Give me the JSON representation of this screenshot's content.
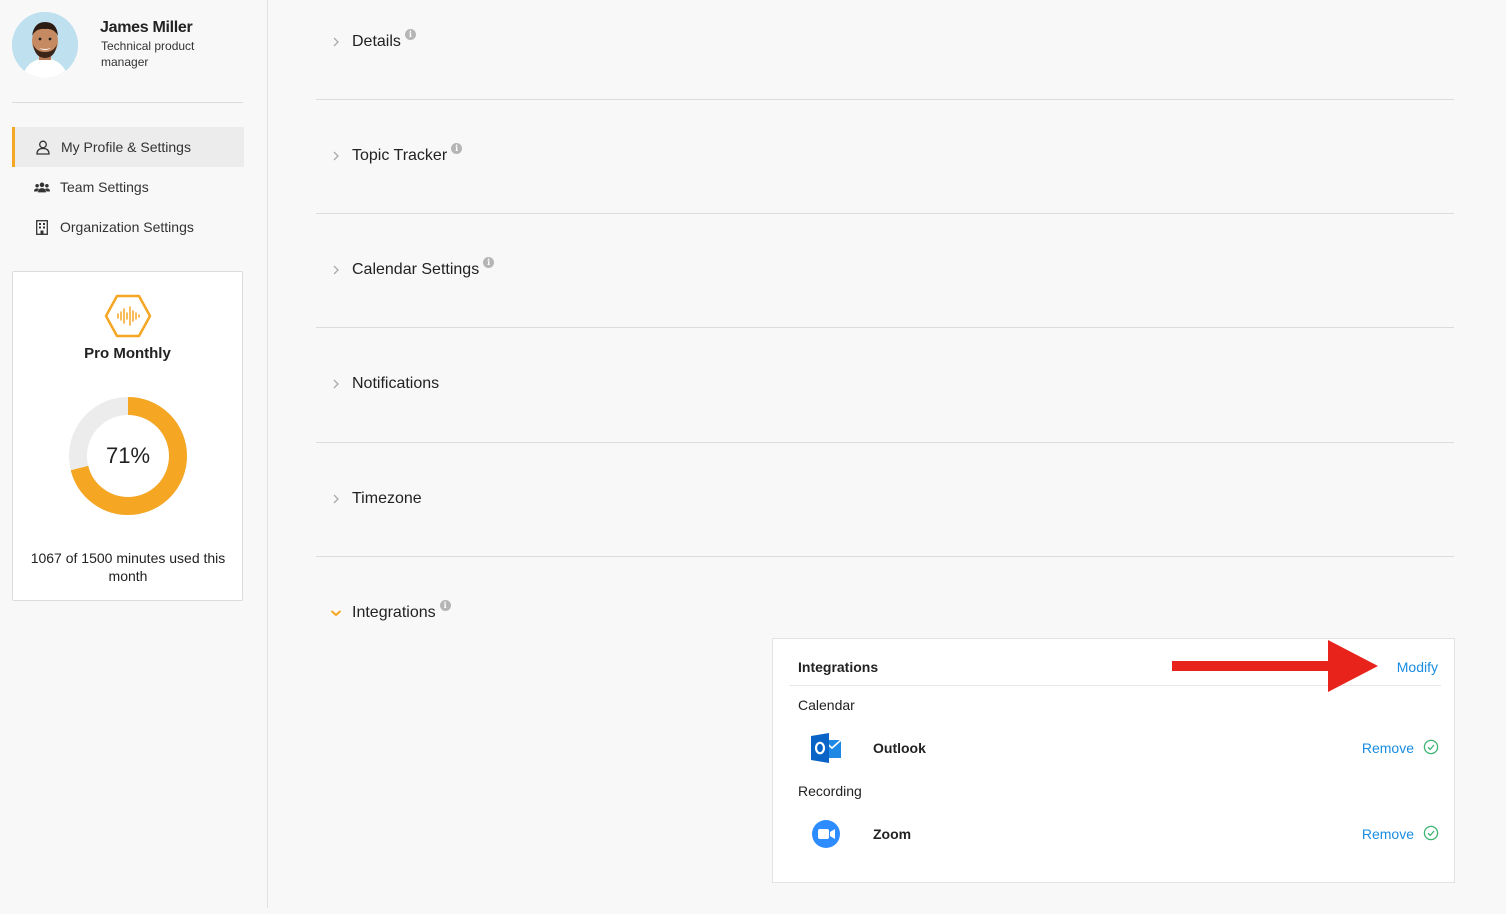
{
  "user": {
    "name": "James Miller",
    "role": "Technical product manager"
  },
  "sidebar": {
    "items": [
      {
        "label": "My Profile & Settings",
        "icon": "user-icon",
        "active": true
      },
      {
        "label": "Team Settings",
        "icon": "team-icon",
        "active": false
      },
      {
        "label": "Organization Settings",
        "icon": "building-icon",
        "active": false
      }
    ]
  },
  "plan": {
    "name": "Pro Monthly",
    "percent_label": "71%",
    "percent_value": 0.71,
    "usage_text": "1067 of 1500 minutes used this month"
  },
  "sections": [
    {
      "title": "Details",
      "info": true,
      "expanded": false
    },
    {
      "title": "Topic Tracker",
      "info": true,
      "expanded": false
    },
    {
      "title": "Calendar Settings",
      "info": true,
      "expanded": false
    },
    {
      "title": "Notifications",
      "info": false,
      "expanded": false
    },
    {
      "title": "Timezone",
      "info": false,
      "expanded": false
    },
    {
      "title": "Integrations",
      "info": true,
      "expanded": true
    }
  ],
  "integrations": {
    "title": "Integrations",
    "modify_label": "Modify",
    "groups": [
      {
        "label": "Calendar",
        "item": {
          "name": "Outlook",
          "action": "Remove",
          "icon": "outlook-icon"
        }
      },
      {
        "label": "Recording",
        "item": {
          "name": "Zoom",
          "action": "Remove",
          "icon": "zoom-icon"
        }
      }
    ]
  },
  "colors": {
    "accent": "#f5a623",
    "link": "#1a8ce0",
    "success": "#3cb371",
    "arrow": "#e8231b",
    "outlook": "#0a64c8",
    "zoom": "#2d8cff"
  }
}
